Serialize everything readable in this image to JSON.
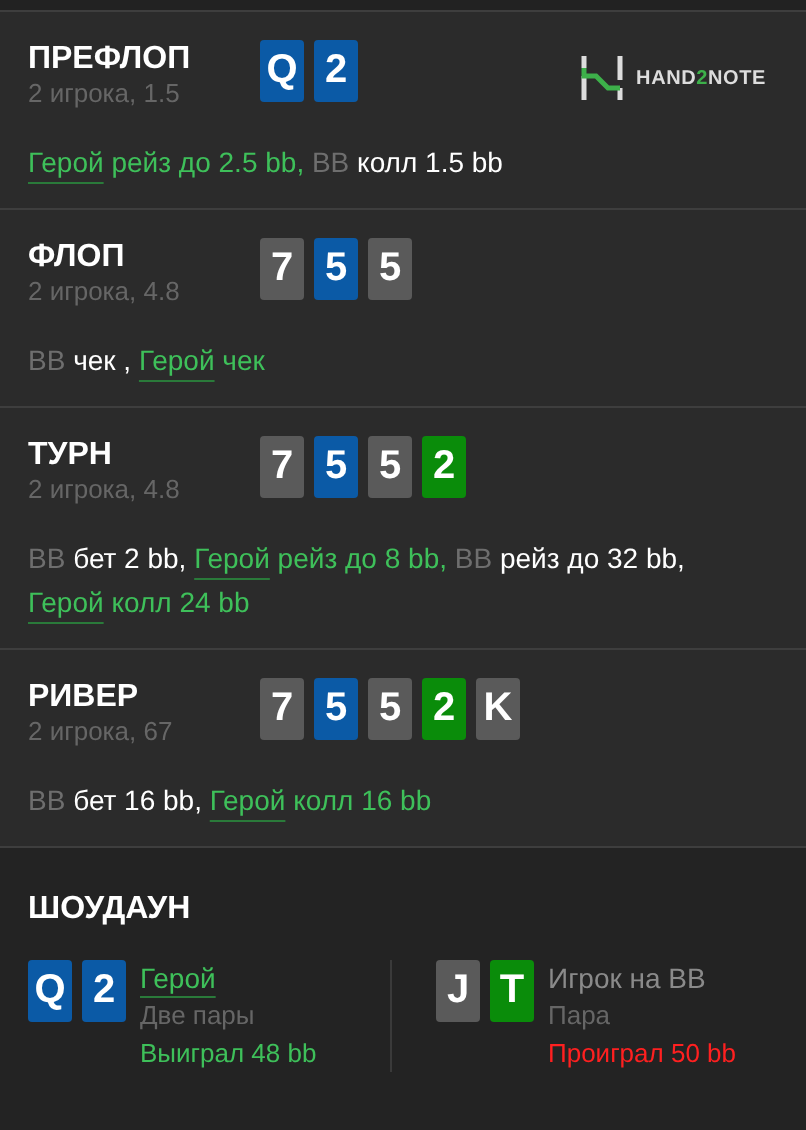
{
  "logo": {
    "before": "HAND",
    "highlight": "2",
    "after": "NOTE"
  },
  "streets": [
    {
      "title": "ПРЕФЛОП",
      "info": "2 игрока, 1.5",
      "cards": [
        {
          "rank": "Q",
          "color": "#0b5aa6"
        },
        {
          "rank": "2",
          "color": "#0b5aa6"
        }
      ],
      "lines": [
        [
          {
            "kind": "hero_name",
            "text": "Герой"
          },
          {
            "kind": "hero_action",
            "text": " рейз до 2.5 bb, "
          },
          {
            "kind": "player_name",
            "text": "BB"
          },
          {
            "kind": "player_action",
            "text": " колл 1.5 bb"
          }
        ]
      ]
    },
    {
      "title": "ФЛОП",
      "info": "2 игрока, 4.8",
      "cards": [
        {
          "rank": "7",
          "color": "#5a5a5a"
        },
        {
          "rank": "5",
          "color": "#0b5aa6"
        },
        {
          "rank": "5",
          "color": "#5a5a5a"
        }
      ],
      "lines": [
        [
          {
            "kind": "player_name",
            "text": "BB"
          },
          {
            "kind": "player_action",
            "text": " чек , "
          },
          {
            "kind": "hero_name",
            "text": "Герой"
          },
          {
            "kind": "hero_action",
            "text": " чек"
          }
        ]
      ]
    },
    {
      "title": "ТУРН",
      "info": "2 игрока, 4.8",
      "cards": [
        {
          "rank": "7",
          "color": "#5a5a5a"
        },
        {
          "rank": "5",
          "color": "#0b5aa6"
        },
        {
          "rank": "5",
          "color": "#5a5a5a"
        },
        {
          "rank": "2",
          "color": "#0a8c0a"
        }
      ],
      "lines": [
        [
          {
            "kind": "player_name",
            "text": "BB"
          },
          {
            "kind": "player_action",
            "text": " бет 2 bb, "
          },
          {
            "kind": "hero_name",
            "text": "Герой"
          },
          {
            "kind": "hero_action",
            "text": " рейз до 8 bb, "
          },
          {
            "kind": "player_name",
            "text": "BB"
          },
          {
            "kind": "player_action",
            "text": " рейз до 32 bb,"
          }
        ],
        [
          {
            "kind": "hero_name",
            "text": "Герой"
          },
          {
            "kind": "hero_action",
            "text": " колл 24 bb"
          }
        ]
      ]
    },
    {
      "title": "РИВЕР",
      "info": "2 игрока, 67",
      "cards": [
        {
          "rank": "7",
          "color": "#5a5a5a"
        },
        {
          "rank": "5",
          "color": "#0b5aa6"
        },
        {
          "rank": "5",
          "color": "#5a5a5a"
        },
        {
          "rank": "2",
          "color": "#0a8c0a"
        },
        {
          "rank": "K",
          "color": "#5a5a5a"
        }
      ],
      "lines": [
        [
          {
            "kind": "player_name",
            "text": "BB"
          },
          {
            "kind": "player_action",
            "text": " бет 16 bb, "
          },
          {
            "kind": "hero_name",
            "text": "Герой"
          },
          {
            "kind": "hero_action",
            "text": " колл 16 bb"
          }
        ]
      ]
    }
  ],
  "showdown": {
    "title": "ШОУДАУН",
    "players": [
      {
        "hero": true,
        "won": true,
        "name": "Герой",
        "hand": "Две пары",
        "result": "Выиграл 48 bb",
        "cards": [
          {
            "rank": "Q",
            "color": "#0b5aa6"
          },
          {
            "rank": "2",
            "color": "#0b5aa6"
          }
        ]
      },
      {
        "hero": false,
        "won": false,
        "name": "Игрок на BB",
        "hand": "Пара",
        "result": "Проиграл 50 bb",
        "cards": [
          {
            "rank": "J",
            "color": "#5a5a5a"
          },
          {
            "rank": "T",
            "color": "#0a8c0a"
          }
        ]
      }
    ]
  }
}
